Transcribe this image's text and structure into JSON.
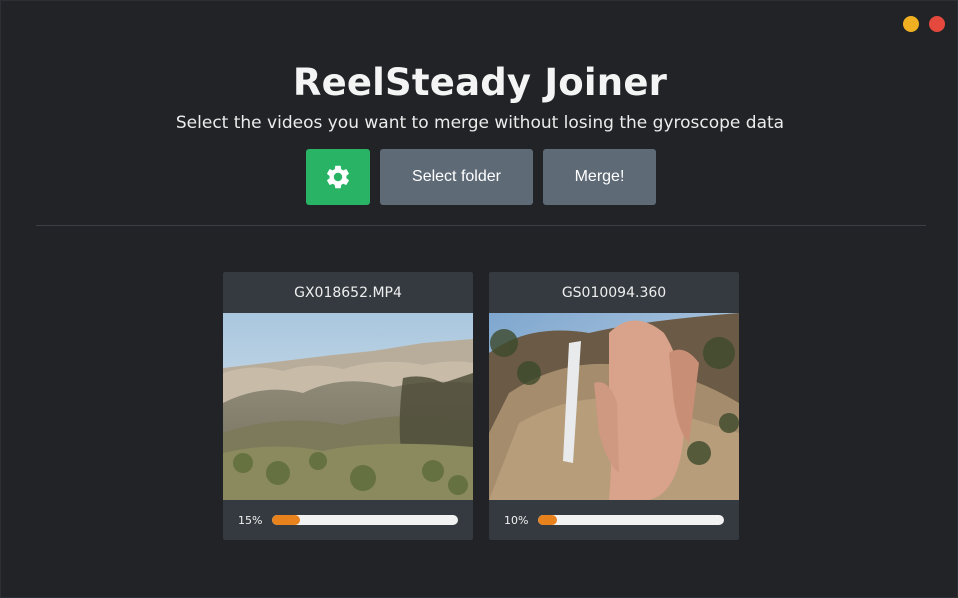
{
  "window": {
    "controls": [
      "minimize",
      "close"
    ],
    "colors": {
      "minimize": "#f0b022",
      "close": "#e5493d"
    }
  },
  "header": {
    "title": "ReelSteady Joiner",
    "subtitle": "Select the videos you want to merge without losing the gyroscope data"
  },
  "toolbar": {
    "settings_icon": "gear-icon",
    "select_folder_label": "Select folder",
    "merge_label": "Merge!",
    "colors": {
      "settings": "#28b464",
      "secondary": "#5f6a77"
    }
  },
  "videos": [
    {
      "filename": "GX018652.MP4",
      "progress_label": "15%",
      "progress": 0.15
    },
    {
      "filename": "GS010094.360",
      "progress_label": "10%",
      "progress": 0.1
    }
  ],
  "progress_color": "#e8821c"
}
